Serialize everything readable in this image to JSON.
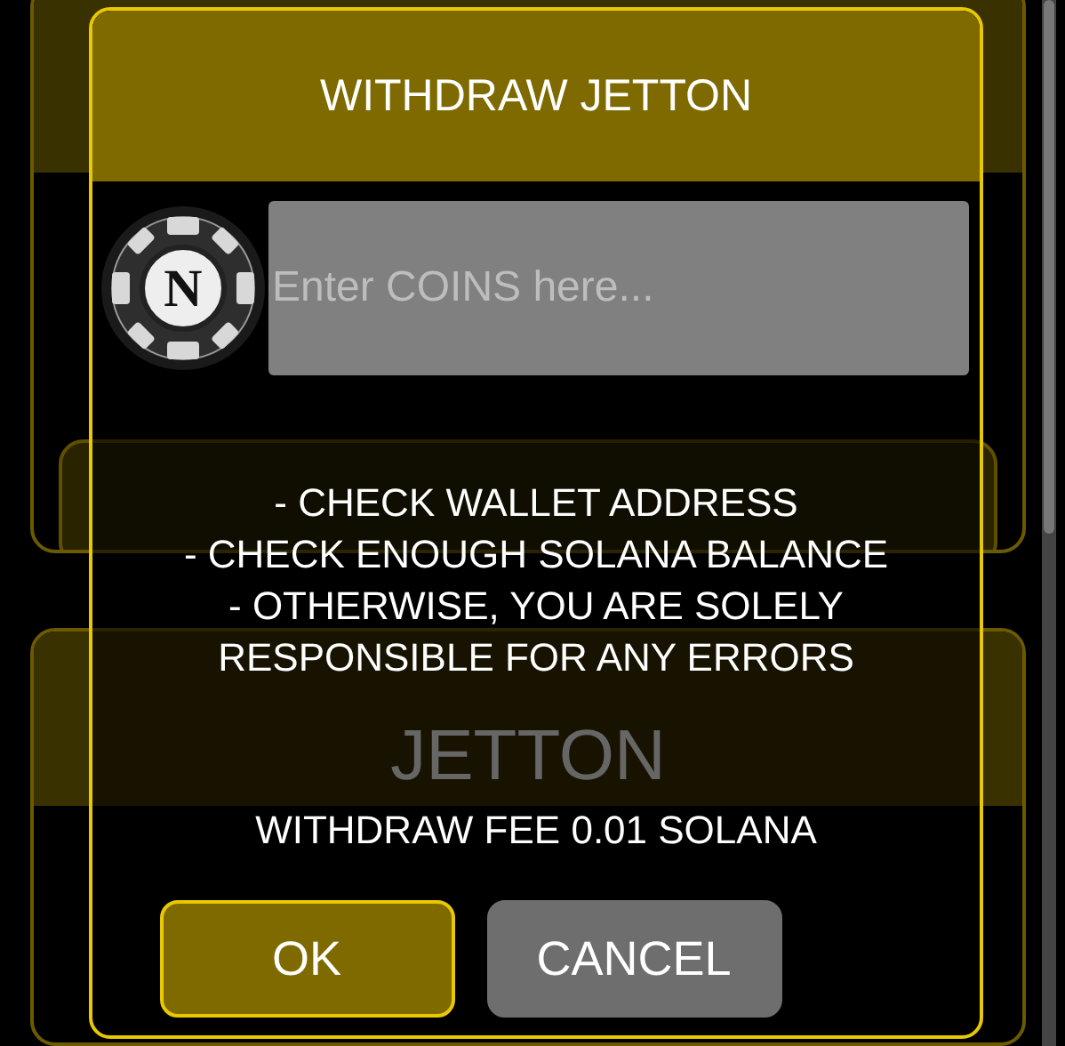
{
  "background": {
    "card_title": "JETTON"
  },
  "dialog": {
    "title": "WITHDRAW JETTON",
    "chip_letter": "N",
    "amount_field": {
      "placeholder": "Enter COINS here..."
    },
    "warnings": [
      "- CHECK WALLET ADDRESS",
      "- CHECK ENOUGH SOLANA BALANCE",
      "- OTHERWISE, YOU ARE SOLELY RESPONSIBLE FOR ANY ERRORS"
    ],
    "fee": "WITHDRAW FEE 0.01 SOLANA",
    "buttons": [
      {
        "label": "OK",
        "kind": "primary"
      },
      {
        "label": "CANCEL",
        "kind": "secondary"
      }
    ]
  }
}
